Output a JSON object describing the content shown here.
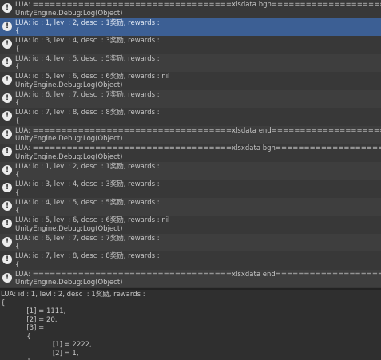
{
  "console": {
    "entries": [
      {
        "line1": "LUA: ===================================xlsdata bgn=========================",
        "line2": "UnityEngine.Debug:Log(Object)",
        "selected": false
      },
      {
        "line1": "LUA: id : 1, levl : 2, desc  : 1奖励, rewards :",
        "line2": "{",
        "selected": true
      },
      {
        "line1": "LUA: id : 3, levl : 4, desc  : 3奖励, rewards :",
        "line2": "{",
        "selected": false
      },
      {
        "line1": "LUA: id : 4, levl : 5, desc  : 5奖励, rewards :",
        "line2": "{",
        "selected": false
      },
      {
        "line1": "LUA: id : 5, levl : 6, desc  : 6奖励, rewards : nil",
        "line2": "UnityEngine.Debug:Log(Object)",
        "selected": false
      },
      {
        "line1": "LUA: id : 6, levl : 7, desc  : 7奖励, rewards :",
        "line2": "{",
        "selected": false
      },
      {
        "line1": "LUA: id : 7, levl : 8, desc  : 8奖励, rewards :",
        "line2": "{",
        "selected": false
      },
      {
        "line1": "LUA: ===================================xlsdata end=========================",
        "line2": "UnityEngine.Debug:Log(Object)",
        "selected": false
      },
      {
        "line1": "LUA: ===================================xlsxdata bgn=========================",
        "line2": "UnityEngine.Debug:Log(Object)",
        "selected": false
      },
      {
        "line1": "LUA: id : 1, levl : 2, desc  : 1奖励, rewards :",
        "line2": "{",
        "selected": false
      },
      {
        "line1": "LUA: id : 3, levl : 4, desc  : 3奖励, rewards :",
        "line2": "{",
        "selected": false
      },
      {
        "line1": "LUA: id : 4, levl : 5, desc  : 5奖励, rewards :",
        "line2": "{",
        "selected": false
      },
      {
        "line1": "LUA: id : 5, levl : 6, desc  : 6奖励, rewards : nil",
        "line2": "UnityEngine.Debug:Log(Object)",
        "selected": false
      },
      {
        "line1": "LUA: id : 6, levl : 7, desc  : 7奖励, rewards :",
        "line2": "{",
        "selected": false
      },
      {
        "line1": "LUA: id : 7, levl : 8, desc  : 8奖励, rewards :",
        "line2": "{",
        "selected": false
      },
      {
        "line1": "LUA: ===================================xlsxdata end=========================",
        "line2": "UnityEngine.Debug:Log(Object)",
        "selected": false
      }
    ]
  },
  "detail": {
    "lines": [
      "LUA: id : 1, levl : 2, desc  : 1奖励, rewards :",
      "{",
      "            [1] = 1111,",
      "            [2] = 20,",
      "            [3] =",
      "            {",
      "                        [1] = 2222,",
      "                        [2] = 1,",
      "            },",
      "},"
    ]
  },
  "icon": {
    "name": "info-icon",
    "glyph": "!"
  }
}
